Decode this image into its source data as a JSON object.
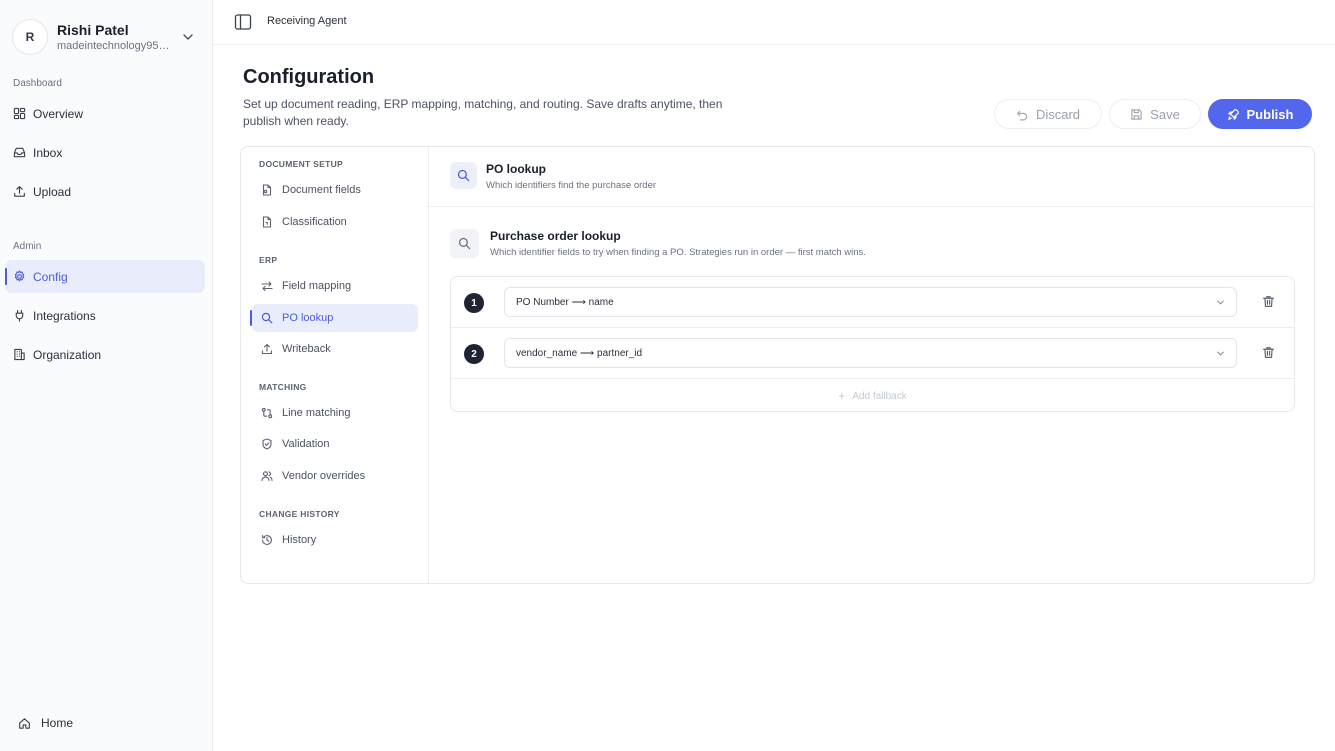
{
  "user": {
    "initial": "R",
    "name": "Rishi Patel",
    "email": "madeintechnology95@..."
  },
  "sidebar": {
    "groups": [
      {
        "label": "Dashboard",
        "items": [
          {
            "label": "Overview",
            "icon": "grid-icon"
          },
          {
            "label": "Inbox",
            "icon": "inbox-icon"
          },
          {
            "label": "Upload",
            "icon": "upload-icon"
          }
        ]
      },
      {
        "label": "Admin",
        "items": [
          {
            "label": "Config",
            "icon": "gear-icon",
            "active": true
          },
          {
            "label": "Integrations",
            "icon": "plug-icon"
          },
          {
            "label": "Organization",
            "icon": "building-icon"
          }
        ]
      }
    ],
    "home_label": "Home"
  },
  "topbar": {
    "title": "Receiving Agent"
  },
  "page": {
    "title": "Configuration",
    "description": "Set up document reading, ERP mapping, matching, and routing. Save drafts anytime, then publish when ready."
  },
  "actions": {
    "discard": "Discard",
    "save": "Save",
    "publish": "Publish"
  },
  "config_nav": {
    "sections": [
      {
        "label": "DOCUMENT SETUP",
        "items": [
          {
            "label": "Document fields",
            "icon": "document-icon"
          },
          {
            "label": "Classification",
            "icon": "file-tag-icon"
          }
        ]
      },
      {
        "label": "ERP",
        "items": [
          {
            "label": "Field mapping",
            "icon": "arrows-icon"
          },
          {
            "label": "PO lookup",
            "icon": "search-icon",
            "active": true
          },
          {
            "label": "Writeback",
            "icon": "upload-icon"
          }
        ]
      },
      {
        "label": "MATCHING",
        "items": [
          {
            "label": "Line matching",
            "icon": "git-compare-icon"
          },
          {
            "label": "Validation",
            "icon": "shield-check-icon"
          },
          {
            "label": "Vendor overrides",
            "icon": "users-icon"
          }
        ]
      },
      {
        "label": "CHANGE HISTORY",
        "items": [
          {
            "label": "History",
            "icon": "history-icon"
          }
        ]
      }
    ]
  },
  "content": {
    "header_title": "PO lookup",
    "header_subtitle": "Which identifiers find the purchase order",
    "section_title": "Purchase order lookup",
    "section_subtitle": "Which identifier fields to try when finding a PO. Strategies run in order — first match wins.",
    "strategies": [
      {
        "order": "1",
        "value": "PO Number ⟶ name"
      },
      {
        "order": "2",
        "value": "vendor_name ⟶ partner_id"
      }
    ],
    "add_fallback": "Add fallback"
  },
  "colors": {
    "accent": "#5366ee",
    "active_bg": "#e9ecfb",
    "active_text": "#4a5fd9"
  }
}
